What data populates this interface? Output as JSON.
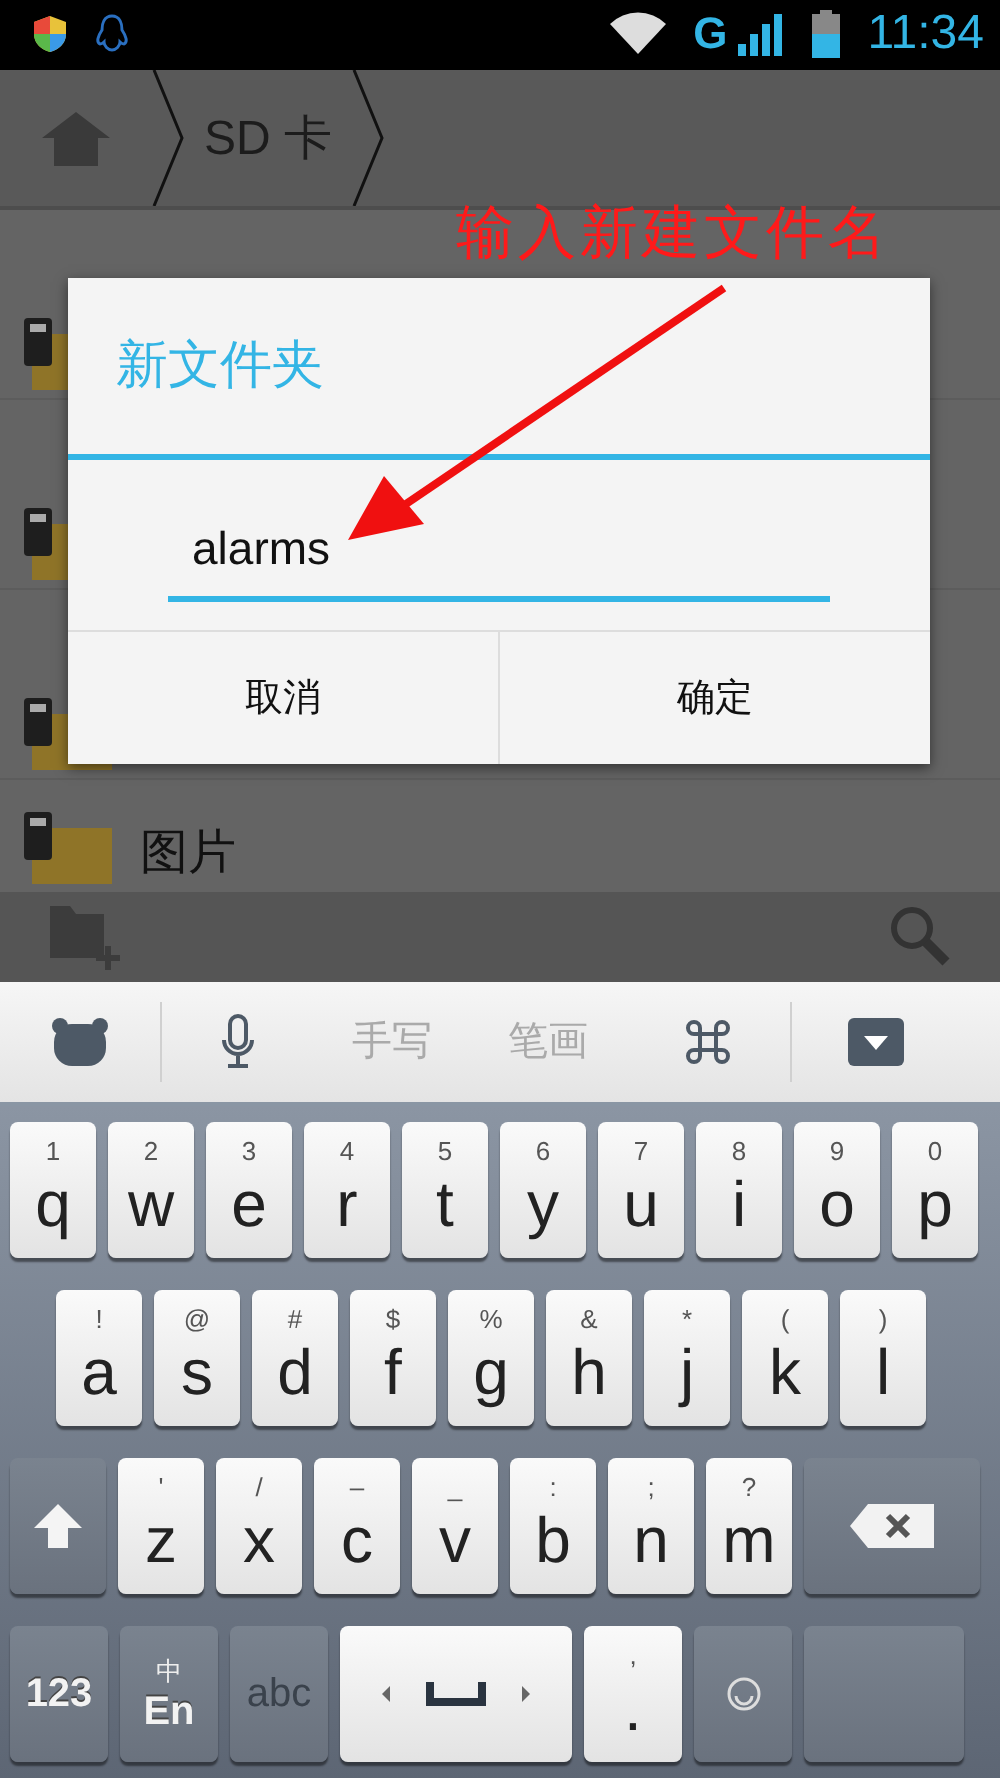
{
  "status_bar": {
    "time": "11:34",
    "network": "G"
  },
  "breadcrumb": {
    "items": [
      "SD 卡"
    ]
  },
  "file_rows": [
    {
      "kind": "covered"
    },
    {
      "kind": "covered"
    },
    {
      "kind": "covered"
    },
    {
      "kind": "named",
      "name": "图片"
    }
  ],
  "dialog": {
    "title": "新文件夹",
    "value": "alarms",
    "buttons": [
      "取消",
      "确定"
    ]
  },
  "annotation": {
    "text": "输入新建文件名"
  },
  "keyboard": {
    "toolbar": [
      {
        "kind": "logo"
      },
      {
        "kind": "mic"
      },
      {
        "kind": "text",
        "label": "手写"
      },
      {
        "kind": "text",
        "label": "笔画"
      },
      {
        "kind": "clover"
      },
      {
        "kind": "hide"
      }
    ],
    "rows": [
      [
        {
          "kind": "char",
          "hint": "1",
          "label": "q"
        },
        {
          "kind": "char",
          "hint": "2",
          "label": "w"
        },
        {
          "kind": "char",
          "hint": "3",
          "label": "e"
        },
        {
          "kind": "char",
          "hint": "4",
          "label": "r"
        },
        {
          "kind": "char",
          "hint": "5",
          "label": "t"
        },
        {
          "kind": "char",
          "hint": "6",
          "label": "y"
        },
        {
          "kind": "char",
          "hint": "7",
          "label": "u"
        },
        {
          "kind": "char",
          "hint": "8",
          "label": "i"
        },
        {
          "kind": "char",
          "hint": "9",
          "label": "o"
        },
        {
          "kind": "char",
          "hint": "0",
          "label": "p"
        }
      ],
      [
        {
          "kind": "char",
          "hint": "!",
          "label": "a"
        },
        {
          "kind": "char",
          "hint": "@",
          "label": "s"
        },
        {
          "kind": "char",
          "hint": "#",
          "label": "d"
        },
        {
          "kind": "char",
          "hint": "$",
          "label": "f"
        },
        {
          "kind": "char",
          "hint": "%",
          "label": "g"
        },
        {
          "kind": "char",
          "hint": "&",
          "label": "h"
        },
        {
          "kind": "char",
          "hint": "*",
          "label": "j"
        },
        {
          "kind": "char",
          "hint": "(",
          "label": "k"
        },
        {
          "kind": "char",
          "hint": ")",
          "label": "l"
        }
      ],
      [
        {
          "kind": "shift"
        },
        {
          "kind": "char",
          "hint": "'",
          "label": "z"
        },
        {
          "kind": "char",
          "hint": "/",
          "label": "x"
        },
        {
          "kind": "char",
          "hint": "–",
          "label": "c"
        },
        {
          "kind": "char",
          "hint": "_",
          "label": "v"
        },
        {
          "kind": "char",
          "hint": ":",
          "label": "b"
        },
        {
          "kind": "char",
          "hint": ";",
          "label": "n"
        },
        {
          "kind": "char",
          "hint": "?",
          "label": "m"
        },
        {
          "kind": "backspace"
        }
      ],
      [
        {
          "kind": "function",
          "label": "123"
        },
        {
          "kind": "lang",
          "hint": "中",
          "label": "En"
        },
        {
          "kind": "function",
          "label": "abc"
        },
        {
          "kind": "space"
        },
        {
          "kind": "punct",
          "hint": ",",
          "label": "."
        },
        {
          "kind": "emoji"
        },
        {
          "kind": "enter"
        }
      ]
    ]
  }
}
